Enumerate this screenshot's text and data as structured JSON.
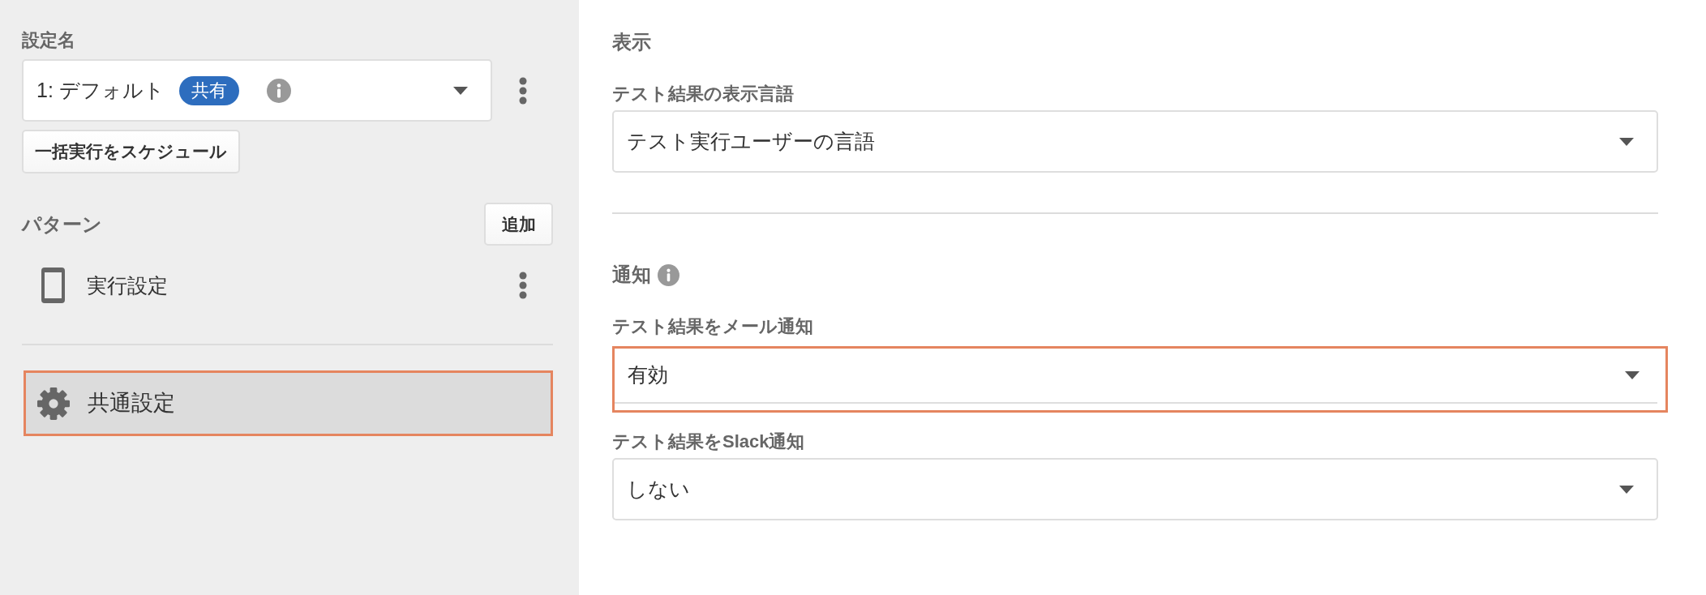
{
  "sidebar": {
    "setting_name": {
      "label": "設定名",
      "value": "1: デフォルト",
      "badge": "共有"
    },
    "schedule_button": "一括実行をスケジュール",
    "patterns": {
      "label": "パターン",
      "add_button": "追加",
      "items": [
        {
          "label": "実行設定"
        }
      ]
    },
    "common_settings": {
      "label": "共通設定",
      "selected": true,
      "highlighted": true
    }
  },
  "sections": [
    {
      "title": "表示",
      "info": false,
      "fields": [
        {
          "label": "テスト結果の表示言語",
          "value": "テスト実行ユーザーの言語",
          "highlighted": false
        }
      ]
    },
    {
      "title": "通知",
      "info": true,
      "fields": [
        {
          "label": "テスト結果をメール通知",
          "value": "有効",
          "highlighted": true
        },
        {
          "label": "テスト結果をSlack通知",
          "value": "しない",
          "highlighted": false
        }
      ]
    }
  ]
}
